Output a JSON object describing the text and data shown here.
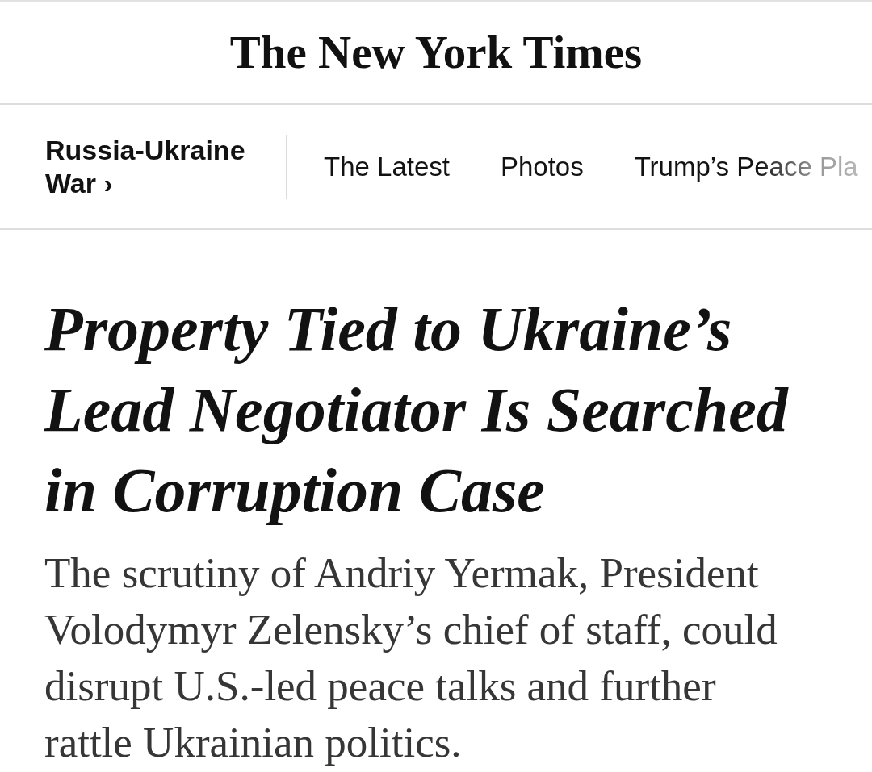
{
  "masthead": {
    "logo": "The New York Times"
  },
  "section_nav": {
    "section": "Russia-Ukraine War ›",
    "links": [
      "The Latest",
      "Photos",
      "Trump’s Peace Pla"
    ]
  },
  "article": {
    "headline": "Property Tied to Ukraine’s Lead Negotiator Is Searched in Corruption Case",
    "summary": "The scrutiny of Andriy Yermak, President Volodymyr Zelensky’s chief of staff, could disrupt U.S.-led peace talks and further rattle Ukrainian politics."
  }
}
